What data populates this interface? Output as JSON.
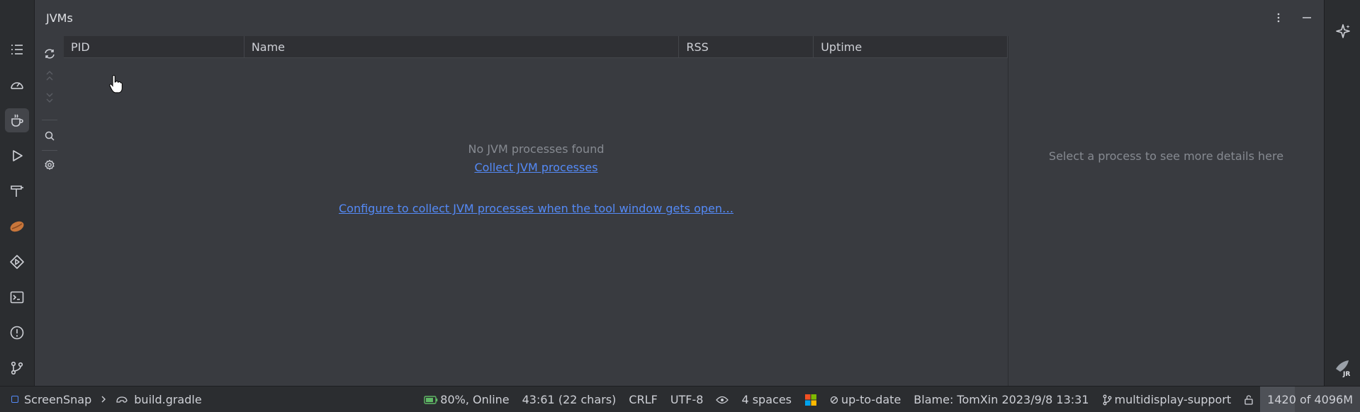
{
  "panel": {
    "title": "JVMs"
  },
  "table": {
    "columns": [
      "PID",
      "Name",
      "RSS",
      "Uptime"
    ],
    "empty_message": "No JVM processes found",
    "collect_link": "Collect JVM processes",
    "configure_link": "Configure to collect JVM processes when the tool window gets open…"
  },
  "details": {
    "placeholder": "Select a process to see more details here"
  },
  "left_toolbar": {
    "icons": [
      "structure-icon",
      "profiler-icon",
      "jvms-icon",
      "run-icon",
      "build-icon",
      "bean-icon",
      "services-icon",
      "terminal-icon",
      "problems-icon",
      "git-icon"
    ]
  },
  "statusbar": {
    "project": "ScreenSnap",
    "file": "build.gradle",
    "battery": "80%, Online",
    "position": "43:61 (22 chars)",
    "line_sep": "CRLF",
    "encoding": "UTF-8",
    "indent": "4 spaces",
    "vcs_status": "up-to-date",
    "blame": "Blame: TomXin 2023/9/8 13:31",
    "branch": "multidisplay-support",
    "memory": "1420 of 4096M",
    "memory_used_fraction": 0.35
  },
  "colors": {
    "accent_link": "#548af7",
    "background": "#393b40",
    "toolbar_bg": "#2b2d30"
  }
}
